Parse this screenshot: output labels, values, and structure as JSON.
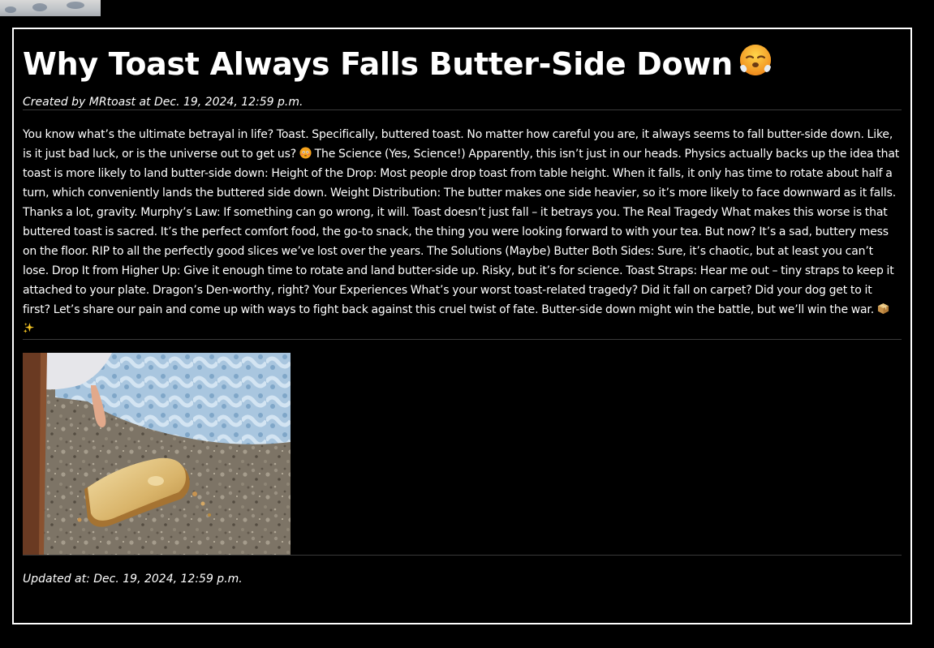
{
  "post": {
    "title": "Why Toast Always Falls Butter-Side Down",
    "title_emoji_icon": "face-with-steam-emoji",
    "byline": "Created by MRtoast at Dec. 19, 2024, 12:59 p.m.",
    "body_part1": "You know what’s the ultimate betrayal in life? Toast. Specifically, buttered toast. No matter how careful you are, it always seems to fall butter-side down. Like, is it just bad luck, or is the universe out to get us?",
    "body_part2": " The Science (Yes, Science!) Apparently, this isn’t just in our heads. Physics actually backs up the idea that toast is more likely to land butter-side down: Height of the Drop: Most people drop toast from table height. When it falls, it only has time to rotate about half a turn, which conveniently lands the buttered side down. Weight Distribution: The butter makes one side heavier, so it’s more likely to face downward as it falls. Thanks a lot, gravity. Murphy’s Law: If something can go wrong, it will. Toast doesn’t just fall – it betrays you. The Real Tragedy What makes this worse is that buttered toast is sacred. It’s the perfect comfort food, the go-to snack, the thing you were looking forward to with your tea. But now? It’s a sad, buttery mess on the floor. RIP to all the perfectly good slices we’ve lost over the years. The Solutions (Maybe) Butter Both Sides: Sure, it’s chaotic, but at least you can’t lose. Drop It from Higher Up: Give it enough time to rotate and land butter-side up. Risky, but it’s for science. Toast Straps: Hear me out – tiny straps to keep it attached to your plate. Dragon’s Den-worthy, right? Your Experiences What’s your worst toast-related tragedy? Did it fall on carpet? Did your dog get to it first? Let’s share our pain and come up with ways to fight back against this cruel twist of fate. Butter-side down might win the battle, but we’ll win the war.",
    "inline_icons": [
      "flushed-face-emoji",
      "package-emoji",
      "sparkles-emoji"
    ],
    "image_alt": "",
    "updated": "Updated at: Dec. 19, 2024, 12:59 p.m."
  }
}
